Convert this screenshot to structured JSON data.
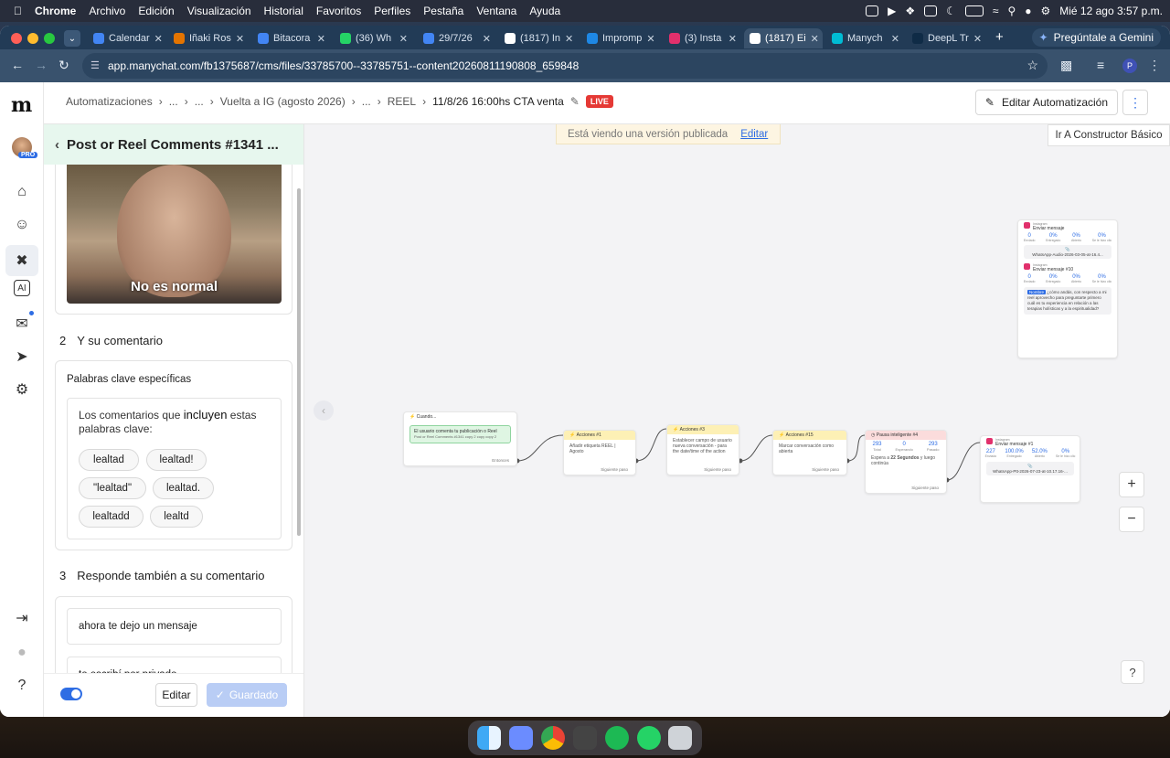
{
  "menubar": {
    "app": "Chrome",
    "items": [
      "Archivo",
      "Edición",
      "Visualización",
      "Historial",
      "Favoritos",
      "Perfiles",
      "Pestaña",
      "Ventana",
      "Ayuda"
    ],
    "datetime": "Mié 12 ago  3:57 p.m."
  },
  "browser": {
    "tabs": [
      {
        "title": "Calendar",
        "color": "#4285f4"
      },
      {
        "title": "Iñaki Ros",
        "color": "#e37400"
      },
      {
        "title": "Bitacora",
        "color": "#4285f4"
      },
      {
        "title": "(36) Wh",
        "color": "#25d366"
      },
      {
        "title": "29/7/26",
        "color": "#4285f4"
      },
      {
        "title": "(1817) In",
        "color": "#ffffff"
      },
      {
        "title": "Impromp",
        "color": "#1e88e5"
      },
      {
        "title": "(3) Insta",
        "color": "#e1306c"
      },
      {
        "title": "(1817) Ei",
        "color": "#ffffff"
      },
      {
        "title": "Manych",
        "color": "#00bcd4"
      },
      {
        "title": "DeepL Tr",
        "color": "#0f2b46"
      }
    ],
    "gemini_label": "Pregúntale a Gemini",
    "url": "app.manychat.com/fb1375687/cms/files/33785700--33785751--content20260811190808_659848",
    "profile_initial": "P"
  },
  "header": {
    "breadcrumbs": [
      "Automatizaciones",
      "...",
      "...",
      "Vuelta a IG (agosto 2026)",
      "...",
      "REEL"
    ],
    "current": "11/8/26 16:00hs CTA venta",
    "live_badge": "LIVE",
    "edit_button": "Editar Automatización"
  },
  "sidebar": {
    "pro_badge": "PRO"
  },
  "panel": {
    "title": "Post or Reel Comments #1341 ...",
    "video_caption": "No es normal",
    "section2_num": "2",
    "section2_title": "Y su comentario",
    "keywords_title": "Palabras clave específicas",
    "keywords_desc_pre": "Los comentarios que",
    "keywords_desc_strong": "incluyen",
    "keywords_desc_post": "estas palabras clave:",
    "keywords": [
      "lealtad",
      "lealtad!",
      "\"lealtad\"",
      "lealtad.",
      "lealtadd",
      "lealtd"
    ],
    "section3_num": "3",
    "section3_title": "Responde también a su comentario",
    "replies": [
      "ahora te dejo un mensaje",
      "te escribí por privado"
    ],
    "edit_label": "Editar",
    "saved_label": "Guardado"
  },
  "canvas": {
    "notice_text": "Está viendo una versión publicada",
    "notice_link": "Editar",
    "basic_builder": "Ir A Constructor Básico",
    "trigger": {
      "title": "Cuando...",
      "text": "El usuario comenta tu publicación o Reel",
      "sub": "Post or Reel Comments #1341 copy 2 copy copy 2",
      "footer": "Entonces"
    },
    "actions1": {
      "title": "Acciones #1",
      "text": "Añadir etiqueta REEL | Agosto",
      "footer": "Siguiente paso"
    },
    "actions3": {
      "title": "Acciones #3",
      "text": "Establecer campo de usuario nueva conversación - para the date/time of the action",
      "footer": "Siguiente paso"
    },
    "actions15": {
      "title": "Acciones #15",
      "text": "Marcar conversación como abierta",
      "footer": "Siguiente paso"
    },
    "pause": {
      "title": "Pausa inteligente #4",
      "stats": [
        "293",
        "0",
        "293"
      ],
      "labels": [
        "Total",
        "Esperando",
        "Pasado"
      ],
      "text_pre": "Espera a",
      "text_bold": "22 Segundos",
      "text_post": "y luego continúa",
      "footer": "Siguiente paso"
    },
    "msg1": {
      "platform": "Instagram",
      "title": "Enviar mensaje #1",
      "stats": [
        "227",
        "100.0%",
        "52.0%",
        "0%"
      ],
      "labels": [
        "Enviado",
        "Entregado",
        "Abierto",
        "Se le hizo clic"
      ],
      "file": "WhatsApp-Ptt-2026-07-23-at-10.17.16-..."
    },
    "msgA": {
      "platform": "Instagram",
      "title": "Enviar mensaje",
      "stats": [
        "0",
        "0%",
        "0%",
        "0%"
      ],
      "labels": [
        "Enviado",
        "Entregado",
        "Abierto",
        "Se le hizo clic"
      ],
      "file": "WhatsApp-Audio-2026-03-05-at-16.4..."
    },
    "msg10": {
      "platform": "Instagram",
      "title": "Enviar mensaje #10",
      "stats": [
        "0",
        "0%",
        "0%",
        "0%"
      ],
      "labels": [
        "Enviado",
        "Entregado",
        "Abierto",
        "Se le hizo clic"
      ],
      "highlight": "Nombre",
      "text": "¿cómo andás, con respecto a mi reel aprovecho para preguntarte primero cuál es tu experiencia en relación a las terapias holísticas y a la espiritualidad?"
    }
  }
}
